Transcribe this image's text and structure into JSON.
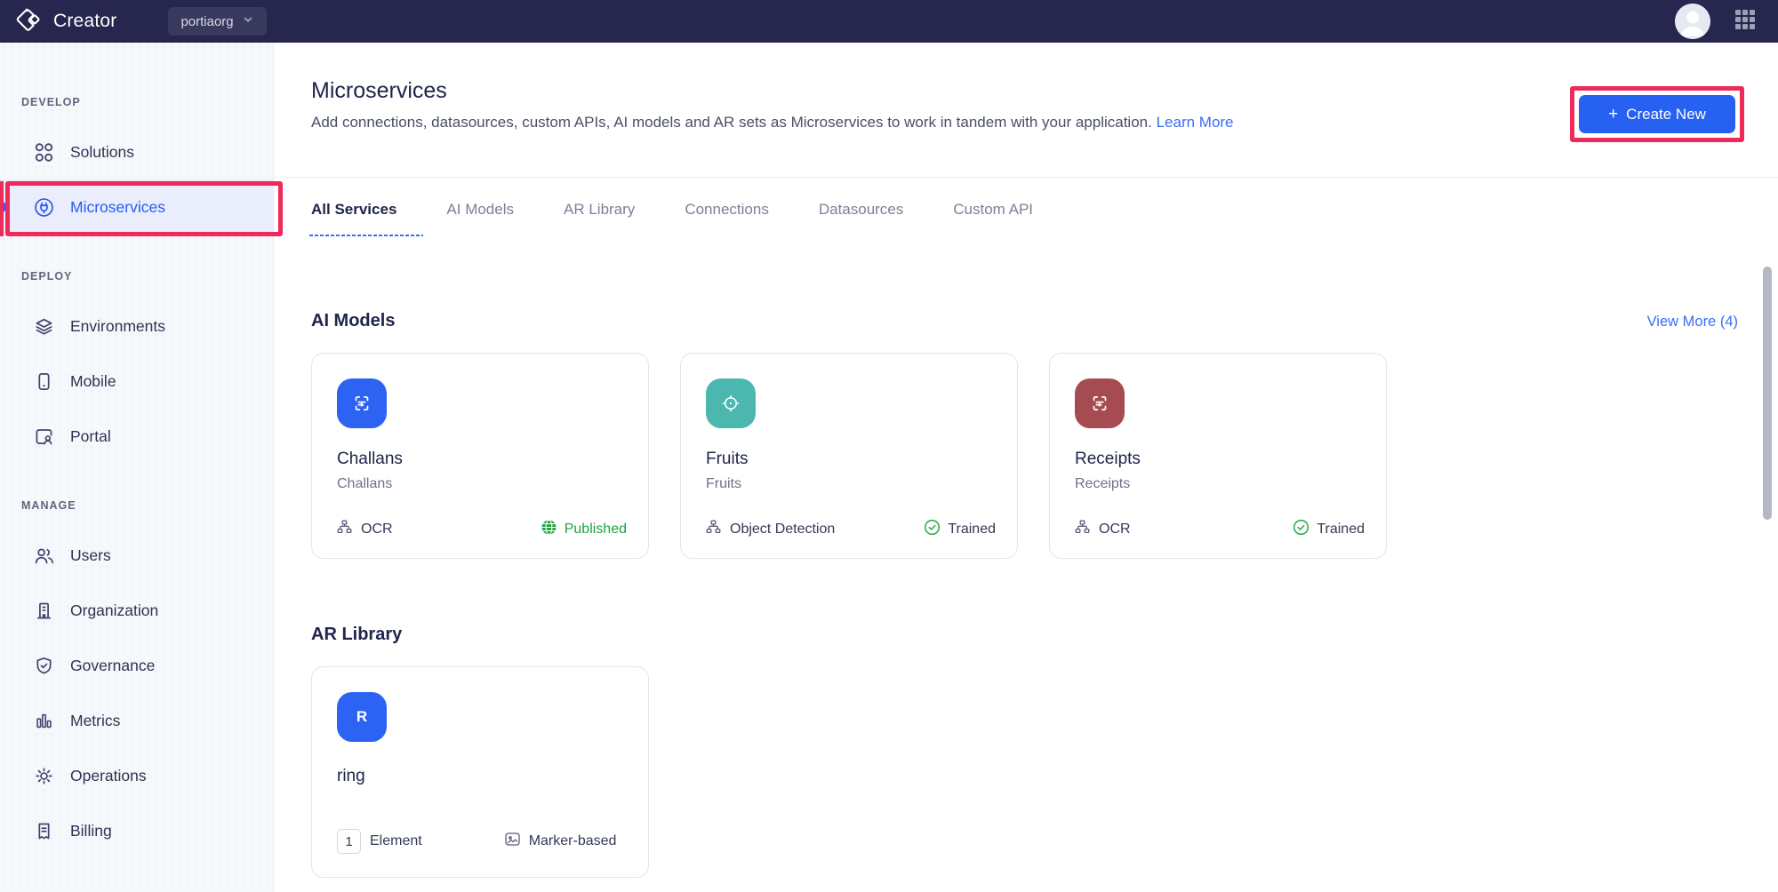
{
  "topbar": {
    "product": "Creator",
    "org": "portiaorg"
  },
  "sidebar": {
    "sections": [
      {
        "label": "DEVELOP",
        "items": [
          {
            "label": "Solutions"
          },
          {
            "label": "Microservices",
            "active": true
          }
        ]
      },
      {
        "label": "DEPLOY",
        "items": [
          {
            "label": "Environments"
          },
          {
            "label": "Mobile"
          },
          {
            "label": "Portal"
          }
        ]
      },
      {
        "label": "MANAGE",
        "items": [
          {
            "label": "Users"
          },
          {
            "label": "Organization"
          },
          {
            "label": "Governance"
          },
          {
            "label": "Metrics"
          },
          {
            "label": "Operations"
          },
          {
            "label": "Billing"
          }
        ]
      }
    ]
  },
  "header": {
    "title": "Microservices",
    "description": "Add connections, datasources, custom APIs, AI models and AR sets as Microservices to work in tandem with your application.",
    "learn_more": "Learn More",
    "create_plus": "+",
    "create_label": "Create New"
  },
  "tabs": {
    "items": [
      {
        "label": "All Services",
        "active": true
      },
      {
        "label": "AI Models"
      },
      {
        "label": "AR Library"
      },
      {
        "label": "Connections"
      },
      {
        "label": "Datasources"
      },
      {
        "label": "Custom API"
      }
    ]
  },
  "ai_models": {
    "title": "AI Models",
    "view_more": "View More (4)",
    "cards": [
      {
        "name": "Challans",
        "description": "Challans",
        "model_type": "OCR",
        "status": "Published",
        "icon": "ocr-scan-icon",
        "icon_bg": "#2c63f2"
      },
      {
        "name": "Fruits",
        "description": "Fruits",
        "model_type": "Object Detection",
        "status": "Trained",
        "icon": "object-detection-icon",
        "icon_bg": "#4bb7af"
      },
      {
        "name": "Receipts",
        "description": "Receipts",
        "model_type": "OCR",
        "status": "Trained",
        "icon": "ocr-scan-icon",
        "icon_bg": "#a64b51"
      }
    ]
  },
  "ar_library": {
    "title": "AR Library",
    "cards": [
      {
        "name": "ring",
        "initial": "R",
        "element_count": "1",
        "element_label": "Element",
        "tracking_type": "Marker-based",
        "icon_bg": "#2c63f2"
      }
    ]
  },
  "colors": {
    "accent_blue": "#2761f2",
    "annotation_red": "#ee2a5a",
    "published_green": "#1fa43d",
    "topbar_bg": "#26264e"
  }
}
